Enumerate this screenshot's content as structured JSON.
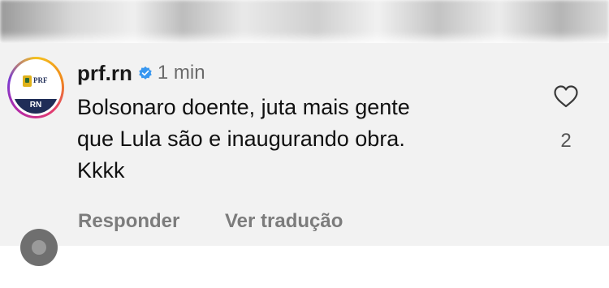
{
  "comment": {
    "username": "prf.rn",
    "verified": true,
    "timestamp": "1 min",
    "avatar": {
      "emblem_text": "PRF",
      "band_text": "RN"
    },
    "text_lines": [
      "Bolsonaro doente, juta mais gente",
      "que Lula são e inaugurando obra.",
      "Kkkk"
    ],
    "like_count": "2",
    "actions": {
      "reply_label": "Responder",
      "translate_label": "Ver tradução"
    }
  },
  "colors": {
    "comment_background": "#f2f2f2",
    "verified_badge": "#3897f0",
    "action_text": "#7c7c7c",
    "logo_navy": "#1f2d57"
  },
  "icons": {
    "like": "heart-outline-icon",
    "verified": "verified-badge-icon"
  }
}
